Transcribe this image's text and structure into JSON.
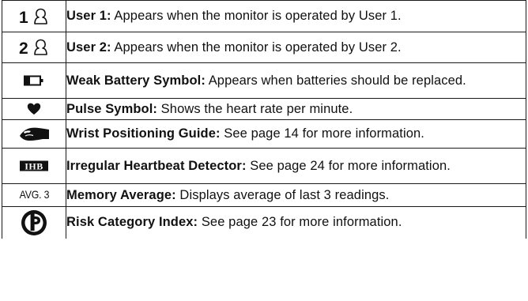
{
  "legend": {
    "rows": [
      {
        "icon": "user-1-icon",
        "icon_text": "1",
        "term": "User 1:",
        "text": " Appears when the monitor is operated by User 1."
      },
      {
        "icon": "user-2-icon",
        "icon_text": "2",
        "term": "User 2:",
        "text": " Appears when the monitor is operated by User 2."
      },
      {
        "icon": "weak-battery-icon",
        "term": "Weak Battery Symbol:",
        "text": " Appears when batteries should be replaced."
      },
      {
        "icon": "heart-icon",
        "term": "Pulse Symbol:",
        "text": " Shows the heart rate per minute."
      },
      {
        "icon": "wrist-guide-icon",
        "term": "Wrist Positioning Guide:",
        "text": " See page 14 for more information."
      },
      {
        "icon": "ihb-icon",
        "icon_text": "IHB",
        "term": "Irregular Heartbeat Detector:",
        "text": " See page 24 for more information."
      },
      {
        "icon": "memory-average-icon",
        "icon_text": "AVG. 3",
        "term": "Memory Average:",
        "text": " Displays average of last 3 readings."
      },
      {
        "icon": "risk-category-icon",
        "term": "Risk Category Index:",
        "text": " See page 23 for more information."
      }
    ]
  },
  "colors": {
    "ink": "#111111",
    "border": "#1a1a1a",
    "background": "#ffffff"
  }
}
